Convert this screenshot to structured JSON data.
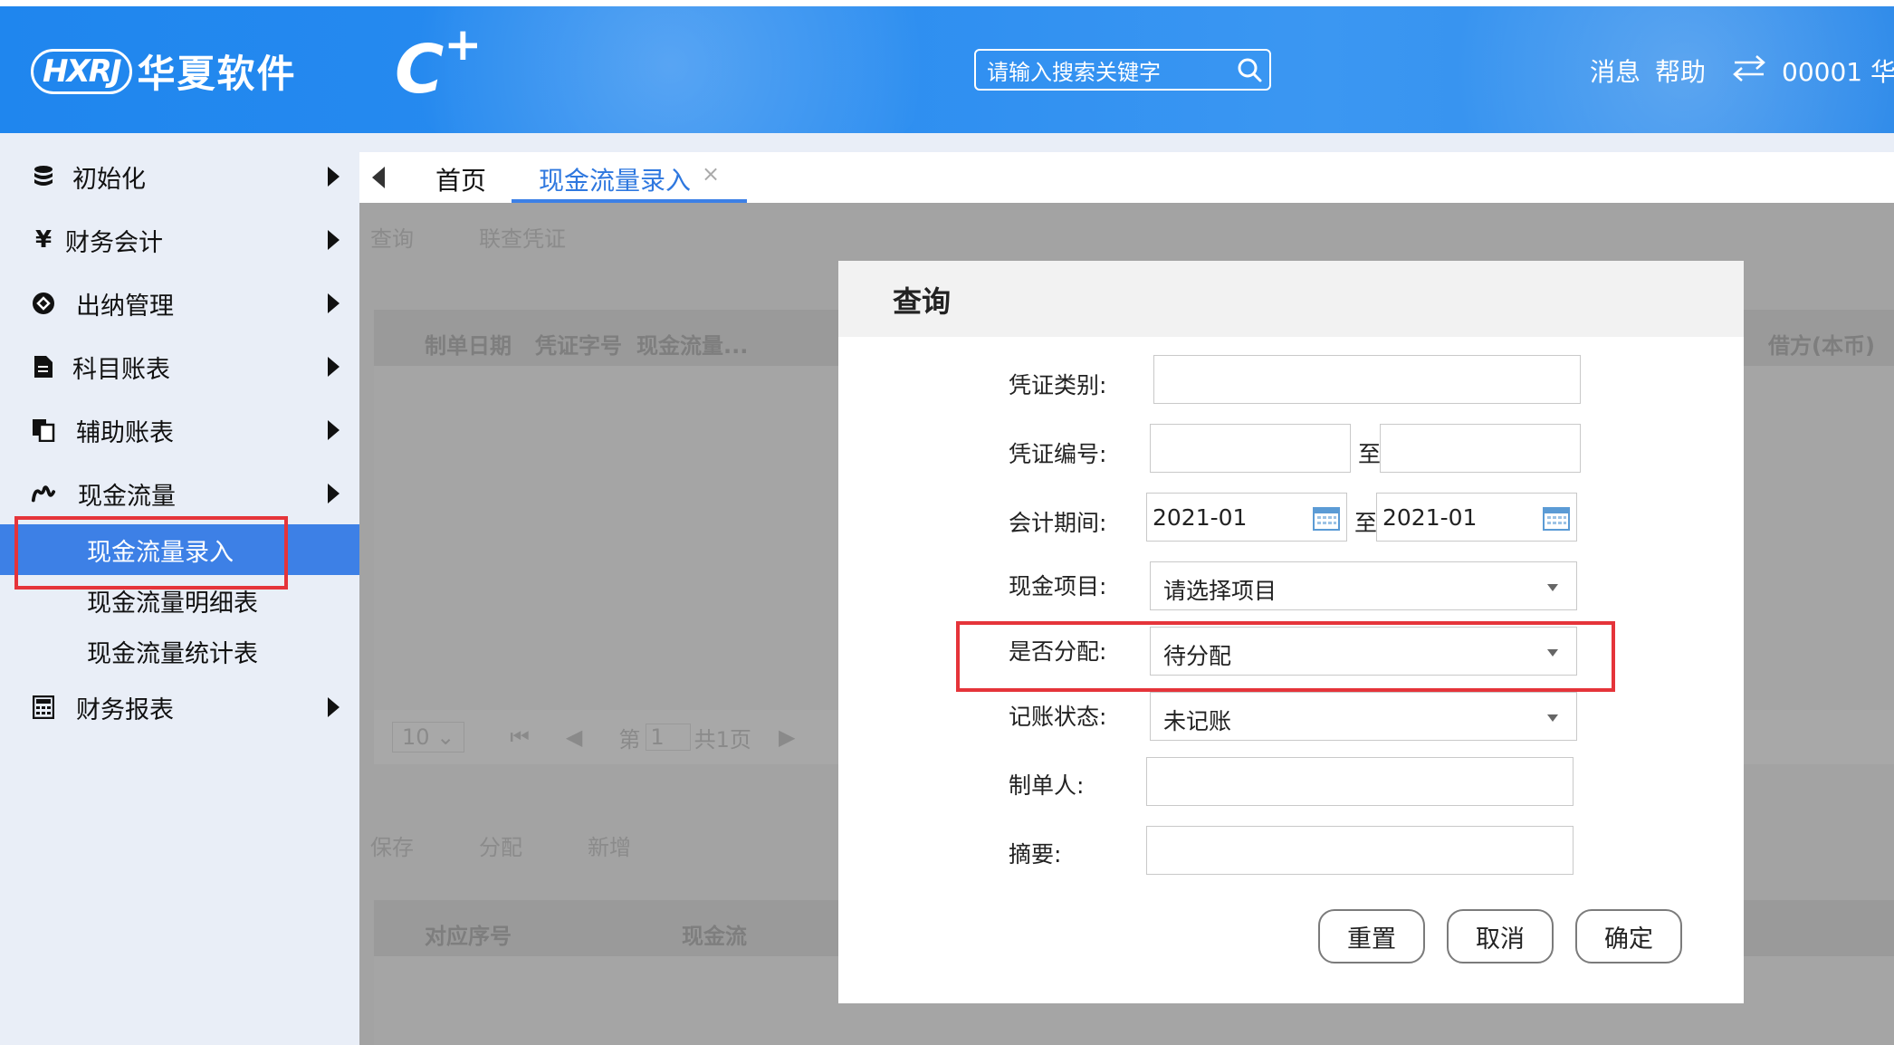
{
  "header": {
    "brand_mark": "HXRJ",
    "brand_name": "华夏软件",
    "product_mark": "C",
    "product_plus": "+",
    "search_placeholder": "请输入搜索关键字",
    "messages": "消息",
    "help": "帮助",
    "user": "00001 华"
  },
  "sidebar": {
    "items": [
      {
        "label": "初始化",
        "icon": "database-icon"
      },
      {
        "label": "财务会计",
        "icon": "yen-icon"
      },
      {
        "label": "出纳管理",
        "icon": "cashier-icon"
      },
      {
        "label": "科目账表",
        "icon": "document-icon"
      },
      {
        "label": "辅助账表",
        "icon": "copy-icon"
      },
      {
        "label": "现金流量",
        "icon": "flow-icon"
      },
      {
        "label": "财务报表",
        "icon": "calculator-icon"
      }
    ],
    "cashflow_sub": [
      "现金流量录入",
      "现金流量明细表",
      "现金流量统计表"
    ]
  },
  "tabs": {
    "home": "首页",
    "active": "现金流量录入",
    "close": "×"
  },
  "background": {
    "toolbar": [
      "查询",
      "联查凭证"
    ],
    "columns": [
      "制单日期",
      "凭证字号",
      "现金流量...",
      "借方(本币)"
    ],
    "pager": {
      "size": "10",
      "page_prefix": "第",
      "page": "1",
      "page_total": "共1页"
    },
    "toolbar2": [
      "保存",
      "分配",
      "新增"
    ],
    "columns2": [
      "对应序号",
      "现金流"
    ]
  },
  "dialog": {
    "title": "查询",
    "voucher_type_label": "凭证类别:",
    "voucher_no_label": "凭证编号:",
    "to": "至",
    "period_label": "会计期间:",
    "period_from": "2021-01",
    "period_to": "2021-01",
    "cash_item_label": "现金项目:",
    "cash_item_value": "请选择项目",
    "allocated_label": "是否分配:",
    "allocated_value": "待分配",
    "posting_label": "记账状态:",
    "posting_value": "未记账",
    "maker_label": "制单人:",
    "summary_label": "摘要:",
    "reset": "重置",
    "cancel": "取消",
    "confirm": "确定"
  },
  "colors": {
    "header_blue": "#2a8cf0",
    "active_blue": "#3d80e6",
    "highlight_red": "#e5343a"
  }
}
